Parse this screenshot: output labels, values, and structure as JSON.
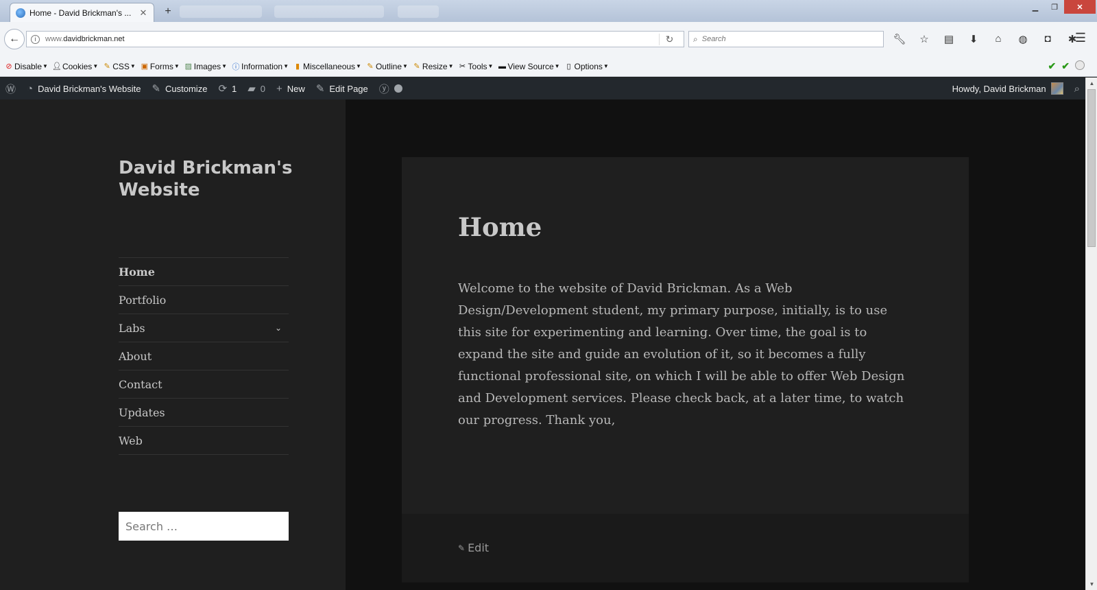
{
  "browser": {
    "tab_title": "Home - David Brickman's ...",
    "new_tab": "+",
    "url_prefix": "www.",
    "url_domain": "davidbrickman.net",
    "search_placeholder": "Search"
  },
  "toolbar": {
    "items": [
      "Disable",
      "Cookies",
      "CSS",
      "Forms",
      "Images",
      "Information",
      "Miscellaneous",
      "Outline",
      "Resize",
      "Tools",
      "View Source",
      "Options"
    ]
  },
  "adminbar": {
    "site_name": "David Brickman's Website",
    "customize": "Customize",
    "updates_count": "1",
    "comments_count": "0",
    "new": "New",
    "edit_page": "Edit Page",
    "howdy": "Howdy, David Brickman"
  },
  "sidebar": {
    "site_title": "David Brickman's Website",
    "menu": [
      {
        "label": "Home"
      },
      {
        "label": "Portfolio"
      },
      {
        "label": "Labs"
      },
      {
        "label": "About"
      },
      {
        "label": "Contact"
      },
      {
        "label": "Updates"
      },
      {
        "label": "Web"
      }
    ],
    "search_placeholder": "Search …"
  },
  "article": {
    "title": "Home",
    "content": "Welcome to the website of David Brickman. As a Web Design/Development student, my primary purpose, initially, is to use this site for experimenting and learning.  Over time, the goal is to expand the site and guide an evolution of it, so it becomes a fully functional professional site, on which I will be able to offer Web Design and Development services.  Please check back, at a later time, to watch our progress.  Thank you,",
    "edit_link": "Edit"
  },
  "colors": {
    "background": "#1f1f1f",
    "main_background": "#111111",
    "adminbar": "#23282d",
    "text": "#c8c8c8"
  }
}
